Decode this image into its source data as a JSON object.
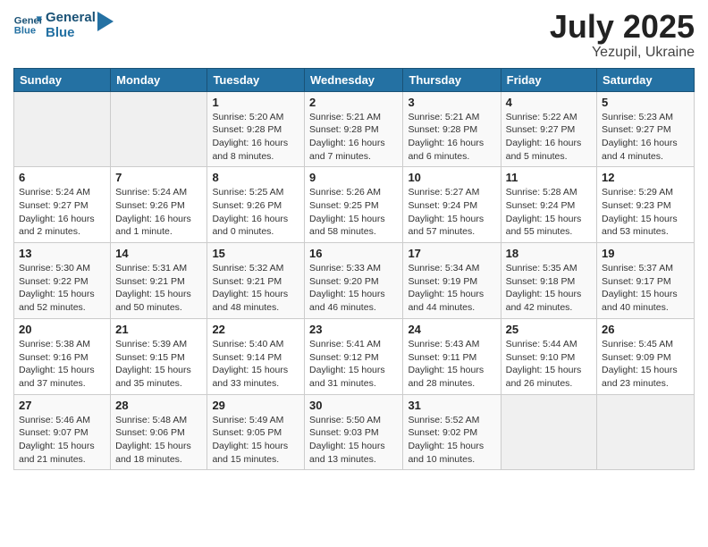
{
  "logo": {
    "line1": "General",
    "line2": "Blue"
  },
  "header": {
    "month": "July 2025",
    "location": "Yezupil, Ukraine"
  },
  "weekdays": [
    "Sunday",
    "Monday",
    "Tuesday",
    "Wednesday",
    "Thursday",
    "Friday",
    "Saturday"
  ],
  "weeks": [
    [
      {
        "day": "",
        "info": ""
      },
      {
        "day": "",
        "info": ""
      },
      {
        "day": "1",
        "info": "Sunrise: 5:20 AM\nSunset: 9:28 PM\nDaylight: 16 hours and 8 minutes."
      },
      {
        "day": "2",
        "info": "Sunrise: 5:21 AM\nSunset: 9:28 PM\nDaylight: 16 hours and 7 minutes."
      },
      {
        "day": "3",
        "info": "Sunrise: 5:21 AM\nSunset: 9:28 PM\nDaylight: 16 hours and 6 minutes."
      },
      {
        "day": "4",
        "info": "Sunrise: 5:22 AM\nSunset: 9:27 PM\nDaylight: 16 hours and 5 minutes."
      },
      {
        "day": "5",
        "info": "Sunrise: 5:23 AM\nSunset: 9:27 PM\nDaylight: 16 hours and 4 minutes."
      }
    ],
    [
      {
        "day": "6",
        "info": "Sunrise: 5:24 AM\nSunset: 9:27 PM\nDaylight: 16 hours and 2 minutes."
      },
      {
        "day": "7",
        "info": "Sunrise: 5:24 AM\nSunset: 9:26 PM\nDaylight: 16 hours and 1 minute."
      },
      {
        "day": "8",
        "info": "Sunrise: 5:25 AM\nSunset: 9:26 PM\nDaylight: 16 hours and 0 minutes."
      },
      {
        "day": "9",
        "info": "Sunrise: 5:26 AM\nSunset: 9:25 PM\nDaylight: 15 hours and 58 minutes."
      },
      {
        "day": "10",
        "info": "Sunrise: 5:27 AM\nSunset: 9:24 PM\nDaylight: 15 hours and 57 minutes."
      },
      {
        "day": "11",
        "info": "Sunrise: 5:28 AM\nSunset: 9:24 PM\nDaylight: 15 hours and 55 minutes."
      },
      {
        "day": "12",
        "info": "Sunrise: 5:29 AM\nSunset: 9:23 PM\nDaylight: 15 hours and 53 minutes."
      }
    ],
    [
      {
        "day": "13",
        "info": "Sunrise: 5:30 AM\nSunset: 9:22 PM\nDaylight: 15 hours and 52 minutes."
      },
      {
        "day": "14",
        "info": "Sunrise: 5:31 AM\nSunset: 9:21 PM\nDaylight: 15 hours and 50 minutes."
      },
      {
        "day": "15",
        "info": "Sunrise: 5:32 AM\nSunset: 9:21 PM\nDaylight: 15 hours and 48 minutes."
      },
      {
        "day": "16",
        "info": "Sunrise: 5:33 AM\nSunset: 9:20 PM\nDaylight: 15 hours and 46 minutes."
      },
      {
        "day": "17",
        "info": "Sunrise: 5:34 AM\nSunset: 9:19 PM\nDaylight: 15 hours and 44 minutes."
      },
      {
        "day": "18",
        "info": "Sunrise: 5:35 AM\nSunset: 9:18 PM\nDaylight: 15 hours and 42 minutes."
      },
      {
        "day": "19",
        "info": "Sunrise: 5:37 AM\nSunset: 9:17 PM\nDaylight: 15 hours and 40 minutes."
      }
    ],
    [
      {
        "day": "20",
        "info": "Sunrise: 5:38 AM\nSunset: 9:16 PM\nDaylight: 15 hours and 37 minutes."
      },
      {
        "day": "21",
        "info": "Sunrise: 5:39 AM\nSunset: 9:15 PM\nDaylight: 15 hours and 35 minutes."
      },
      {
        "day": "22",
        "info": "Sunrise: 5:40 AM\nSunset: 9:14 PM\nDaylight: 15 hours and 33 minutes."
      },
      {
        "day": "23",
        "info": "Sunrise: 5:41 AM\nSunset: 9:12 PM\nDaylight: 15 hours and 31 minutes."
      },
      {
        "day": "24",
        "info": "Sunrise: 5:43 AM\nSunset: 9:11 PM\nDaylight: 15 hours and 28 minutes."
      },
      {
        "day": "25",
        "info": "Sunrise: 5:44 AM\nSunset: 9:10 PM\nDaylight: 15 hours and 26 minutes."
      },
      {
        "day": "26",
        "info": "Sunrise: 5:45 AM\nSunset: 9:09 PM\nDaylight: 15 hours and 23 minutes."
      }
    ],
    [
      {
        "day": "27",
        "info": "Sunrise: 5:46 AM\nSunset: 9:07 PM\nDaylight: 15 hours and 21 minutes."
      },
      {
        "day": "28",
        "info": "Sunrise: 5:48 AM\nSunset: 9:06 PM\nDaylight: 15 hours and 18 minutes."
      },
      {
        "day": "29",
        "info": "Sunrise: 5:49 AM\nSunset: 9:05 PM\nDaylight: 15 hours and 15 minutes."
      },
      {
        "day": "30",
        "info": "Sunrise: 5:50 AM\nSunset: 9:03 PM\nDaylight: 15 hours and 13 minutes."
      },
      {
        "day": "31",
        "info": "Sunrise: 5:52 AM\nSunset: 9:02 PM\nDaylight: 15 hours and 10 minutes."
      },
      {
        "day": "",
        "info": ""
      },
      {
        "day": "",
        "info": ""
      }
    ]
  ]
}
